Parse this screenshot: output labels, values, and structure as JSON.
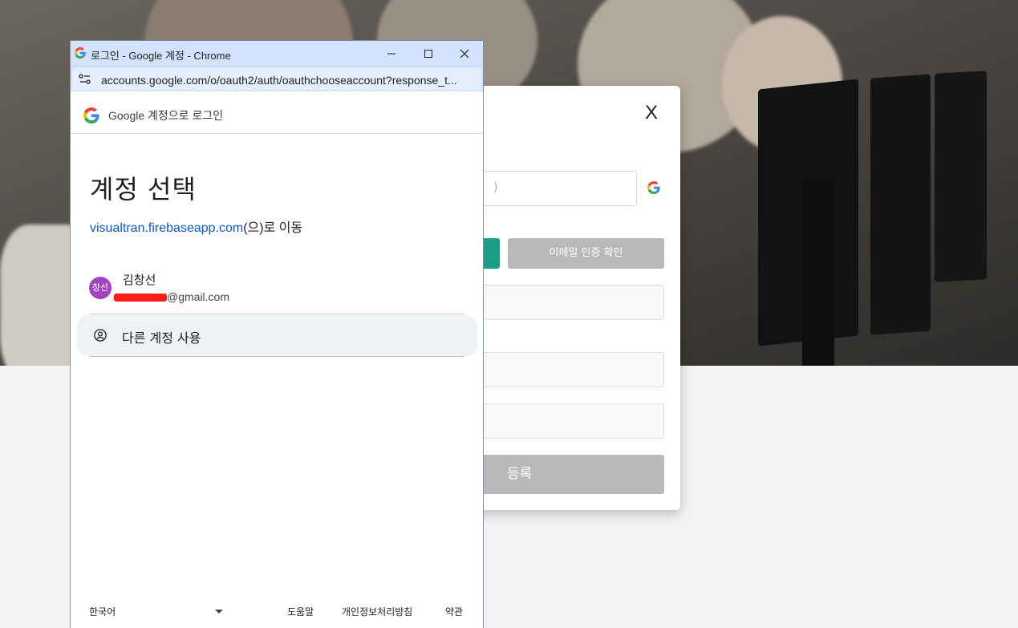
{
  "background_page": {
    "modal": {
      "close_label": "X",
      "email_placeholder": ")",
      "verify_email_button": "이메일 인증 확인",
      "register_button": "등록"
    }
  },
  "popup": {
    "window_title": "로그인 - Google 계정 - Chrome",
    "url": "accounts.google.com/o/oauth2/auth/oauthchooseaccount?response_t...",
    "header_text": "Google 계정으로 로그인",
    "heading": "계정 선택",
    "continue_site": "visualtran.firebaseapp.com",
    "continue_suffix": "(으)로 이동",
    "account": {
      "avatar_text": "창선",
      "name": "김창선",
      "email_domain": "@gmail.com"
    },
    "use_other_account": "다른 계정 사용",
    "footer": {
      "language": "한국어",
      "help": "도움말",
      "privacy": "개인정보처리방침",
      "terms": "약관"
    }
  },
  "colors": {
    "google_blue": "#0b57d0",
    "avatar_purple": "#a142c2",
    "titlebar_blue": "#d3e3fd",
    "modal_green": "#1a9e86"
  },
  "icons": {
    "favicon": "google-g-icon",
    "minimize": "minimize-icon",
    "maximize": "maximize-icon",
    "close": "close-icon",
    "site_settings": "tune-icon",
    "other_account": "account-circle-icon",
    "language_caret": "caret-down-icon"
  }
}
